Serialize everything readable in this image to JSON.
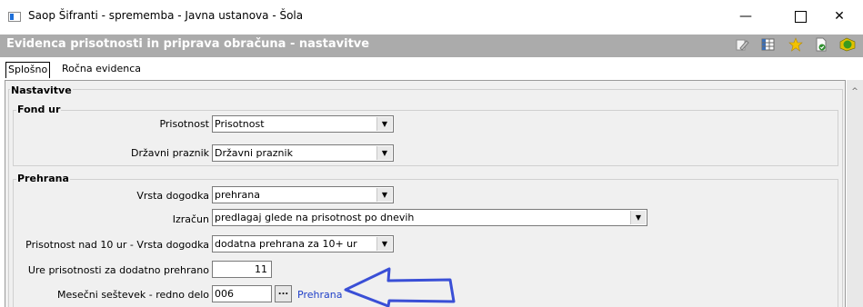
{
  "window": {
    "title": "Saop Šifranti - sprememba - Javna ustanova - Šola",
    "minimize_glyph": "—",
    "close_glyph": "✕"
  },
  "header": {
    "title": "Evidenca prisotnosti in priprava obračuna - nastavitve",
    "icons": [
      "edit-icon",
      "grid-icon",
      "star-icon",
      "document-icon",
      "exit-icon"
    ],
    "colors": {
      "band": "#ababab",
      "star": "#f2c200",
      "exit": "#3a9a1e",
      "document": "#2f8f2f"
    }
  },
  "tabs": [
    {
      "label": "Splošno",
      "active": true
    },
    {
      "label": "Ročna evidenca",
      "active": false
    }
  ],
  "sections": {
    "nastavitve": {
      "title": "Nastavitve"
    },
    "fond_ur": {
      "title": "Fond ur",
      "prisotnost": {
        "label": "Prisotnost",
        "value": "Prisotnost"
      },
      "drzavni_praznik": {
        "label": "Državni praznik",
        "value": "Državni praznik"
      }
    },
    "prehrana": {
      "title": "Prehrana",
      "vrsta_dogodka": {
        "label": "Vrsta dogodka",
        "value": "prehrana"
      },
      "izracun": {
        "label": "Izračun",
        "value": "predlagaj glede na prisotnost po dnevih"
      },
      "nad_10": {
        "label": "Prisotnost nad 10 ur - Vrsta dogodka",
        "value": "dodatna prehrana za 10+ ur"
      },
      "ure_prisotnosti": {
        "label": "Ure prisotnosti za dodatno prehrano",
        "value": "11"
      },
      "mesecni": {
        "label": "Mesečni seštevek - redno delo",
        "value": "006",
        "browse": "...",
        "link": "Prehrana"
      }
    }
  },
  "annotation": {
    "shape": "arrow-pointing-left",
    "color": "#3a4fd6"
  }
}
